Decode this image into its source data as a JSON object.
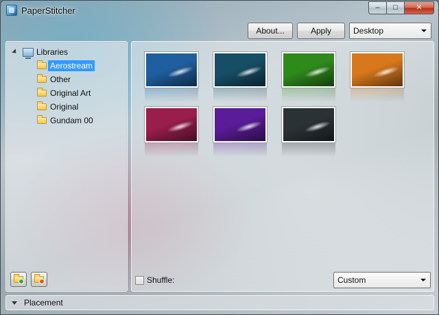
{
  "window": {
    "title": "PaperStitcher",
    "minimize_glyph": "–",
    "maximize_glyph": "□",
    "close_glyph": "✕"
  },
  "toolbar": {
    "about_label": "About...",
    "apply_label": "Apply",
    "target_select": {
      "selected": "Desktop"
    }
  },
  "tree": {
    "root_label": "Libraries",
    "items": [
      {
        "label": "Aerostream",
        "selected": true
      },
      {
        "label": "Other",
        "selected": false
      },
      {
        "label": "Original Art",
        "selected": false
      },
      {
        "label": "Original",
        "selected": false
      },
      {
        "label": "Gundam 00",
        "selected": false
      }
    ]
  },
  "gallery": {
    "thumbnails": [
      {
        "name": "blue",
        "color": "#1f5f9f"
      },
      {
        "name": "teal",
        "color": "#164e66"
      },
      {
        "name": "green",
        "color": "#2f8a1c"
      },
      {
        "name": "orange",
        "color": "#d7781c"
      },
      {
        "name": "magenta",
        "color": "#9a1e4c"
      },
      {
        "name": "purple",
        "color": "#5a1c98"
      },
      {
        "name": "dark",
        "color": "#2b3236"
      }
    ]
  },
  "bottom": {
    "shuffle_label": "Shuffle:",
    "shuffle_checked": false,
    "mode_select": {
      "selected": "Custom"
    }
  },
  "placement": {
    "label": "Placement"
  },
  "icons": {
    "app": "app-icon",
    "libraries": "libraries-icon",
    "folder": "folder-icon",
    "add_folder": "add-folder-icon",
    "remove_folder": "remove-folder-icon"
  }
}
